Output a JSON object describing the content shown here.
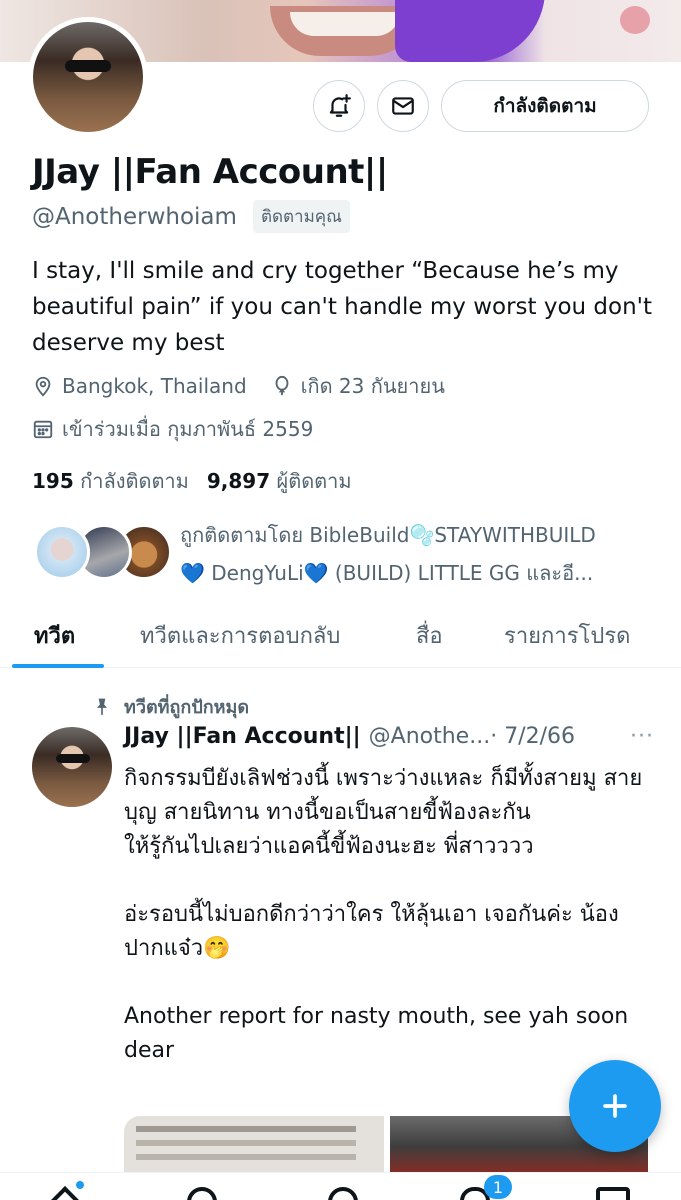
{
  "profile": {
    "name": "JJay ||Fan Account||",
    "handle": "@Anotherwhoiam",
    "follows_you": "ติดตามคุณ",
    "follow_button": "กำลังติดตาม",
    "bio": "I stay, I'll smile and cry together “Because he’s my beautiful pain” if you can't handle my worst you don't deserve my best",
    "location": "Bangkok, Thailand",
    "birthday": "เกิด 23 กันยายน",
    "joined": "เข้าร่วมเมื่อ กุมภาพันธ์ 2559",
    "following_count": "195",
    "following_label": "กำลังติดตาม",
    "followers_count": "9,897",
    "followers_label": "ผู้ติดตาม",
    "followed_by_prefix": "ถูกติดตามโดย BibleBuild",
    "followed_by_line1_rest": "STAYWITHBUILD",
    "followed_by_name2": "DengYuLi",
    "followed_by_rest": "(BUILD) LITTLE GG และอี...",
    "bubbles_emoji": "🫧",
    "heart_emoji": "💙"
  },
  "tabs": [
    "ทวีต",
    "ทวีตและการตอบกลับ",
    "สื่อ",
    "รายการโปรด"
  ],
  "pinned_tweet": {
    "pinned_label": "ทวีตที่ถูกปักหมุด",
    "author_name": "JJay ||Fan Account||",
    "author_handle": "@Anothe...",
    "date": "· 7/2/66",
    "more": "···",
    "text": "กิจกรรมบียังเลิฟช่วงนี้ เพราะว่างแหละ ก็มีทั้งสายมู สายบุญ สายนิทาน ทางนี้ขอเป็นสายขี้ฟ้องละกัน\nให้รู้กันไปเลยว่าแอคนี้ขี้ฟ้องนะฮะ พี่สาวววว\n\nอ่ะรอบนี้ไม่บอกดีกว่าว่าใคร ให้ลุ้นเอา เจอกันค่ะ น้องปากแจ๋ว🤭\n\nAnother report for nasty mouth, see yah soon dear"
  },
  "bottom_nav": {
    "notification_badge": "1"
  },
  "colors": {
    "accent": "#1d9bf0",
    "text": "#0f1419",
    "secondary": "#536471"
  }
}
